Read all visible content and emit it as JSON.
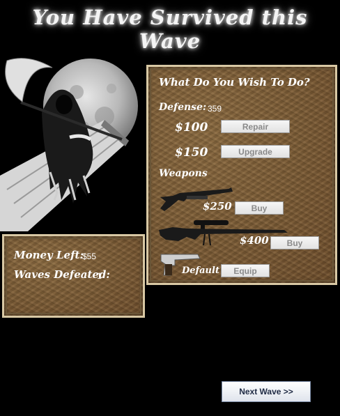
{
  "header": {
    "title": "You Have Survived this Wave"
  },
  "actions_panel": {
    "heading": "What Do You Wish To Do?",
    "defense_label": "Defense:",
    "defense_value": "359",
    "repair": {
      "price": "$100",
      "button": "Repair"
    },
    "upgrade": {
      "price": "$150",
      "button": "Upgrade"
    },
    "weapons_label": "Weapons",
    "weapons": [
      {
        "icon": "shotgun-icon",
        "price": "$250",
        "button": "Buy"
      },
      {
        "icon": "sniper-rifle-icon",
        "price": "$400",
        "button": "Buy"
      },
      {
        "icon": "pistol-icon",
        "price": "Default",
        "button": "Equip"
      }
    ]
  },
  "stats_panel": {
    "money_label": "Money Left:",
    "money_value": "$55",
    "waves_label": "Waves Defeated:",
    "waves_value": "1"
  },
  "footer": {
    "next_button": "Next Wave >>"
  },
  "colors": {
    "panel_brown": "#7c5a34",
    "panel_border": "#d8c8a4",
    "background": "#000000"
  }
}
